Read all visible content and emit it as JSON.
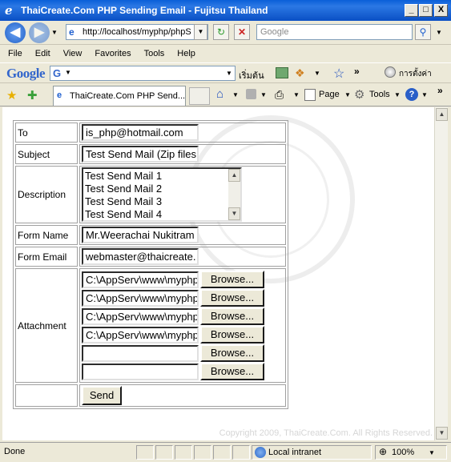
{
  "window": {
    "title": "ThaiCreate.Com PHP Sending Email - Fujitsu Thailand",
    "minimize": "_",
    "maximize": "□",
    "close": "X"
  },
  "address_bar": {
    "url": "http://localhost/myphp/phpS",
    "search_placeholder": "Google"
  },
  "menu": [
    "File",
    "Edit",
    "View",
    "Favorites",
    "Tools",
    "Help"
  ],
  "google_toolbar": {
    "logo": "Google",
    "search_prefix": "G",
    "start_label": "เริ่มต้น",
    "settings_label": "การตั้งค่า"
  },
  "tabs": {
    "active_title": "ThaiCreate.Com PHP Send...",
    "page_label": "Page",
    "tools_label": "Tools"
  },
  "form": {
    "to_label": "To",
    "to_value": "is_php@hotmail.com",
    "subject_label": "Subject",
    "subject_value": "Test Send Mail (Zip files",
    "description_label": "Description",
    "description_lines": [
      "Test Send Mail 1",
      "Test Send Mail 2",
      "Test Send Mail 3",
      "Test Send Mail 4"
    ],
    "form_name_label": "Form Name",
    "form_name_value": "Mr.Weerachai Nukitram",
    "form_email_label": "Form Email",
    "form_email_value": "webmaster@thaicreate.",
    "attachment_label": "Attachment",
    "attachments": [
      "C:\\AppServ\\www\\myphp",
      "C:\\AppServ\\www\\myphp",
      "C:\\AppServ\\www\\myphp",
      "C:\\AppServ\\www\\myphp",
      "",
      ""
    ],
    "browse_label": "Browse...",
    "send_label": "Send"
  },
  "page_footer": {
    "copyright": "Copyright 2009, ThaiCreate.Com. All Rights Reserved."
  },
  "status_bar": {
    "status": "Done",
    "zone": "Local intranet",
    "zoom": "100%"
  }
}
